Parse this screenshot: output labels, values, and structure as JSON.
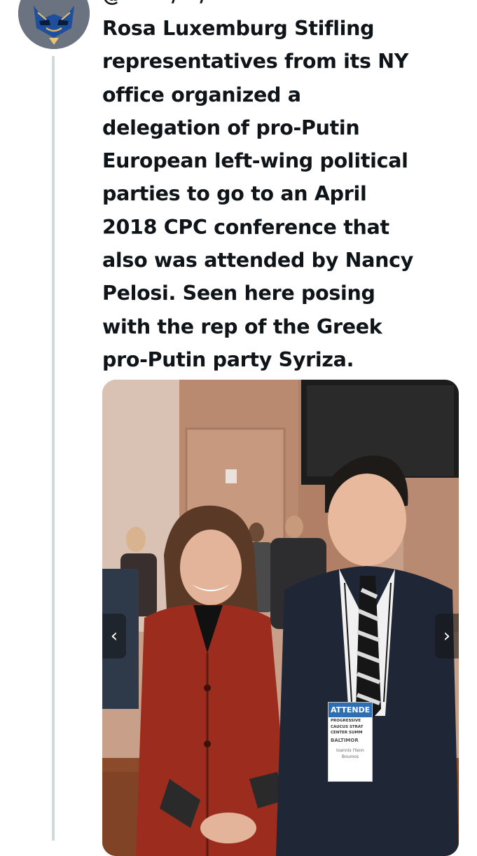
{
  "author": {
    "avatar_icon": "mask-avatar-icon",
    "clipped_header_text": "@ · · · / · / ·"
  },
  "tweet": {
    "lines": [
      "Rosa Luxemburg Stifling",
      "representatives from its NY",
      "office organized a",
      "delegation of pro-Putin",
      "European left-wing political",
      "parties to go to an April",
      "2018 CPC conference that",
      "also was attended by Nancy",
      "Pelosi. Seen here posing",
      "with the rep of the Greek",
      "pro-Putin party Syriza."
    ]
  },
  "media": {
    "prev_icon": "chevron-left-icon",
    "next_icon": "chevron-right-icon",
    "prev_glyph": "‹",
    "next_glyph": "›",
    "badge": {
      "header": "ATTENDE",
      "line1": "PROGRESSIVE",
      "line2": "CAUCUS STRAT",
      "line3": "CENTER SUMM",
      "city": "BALTIMOR",
      "name1": "Ioannis (Yann",
      "name2": "Boumos"
    }
  },
  "colors": {
    "text": "#0f1419",
    "thread_line": "#cfd9de",
    "badge_blue": "#2c6fb4"
  }
}
